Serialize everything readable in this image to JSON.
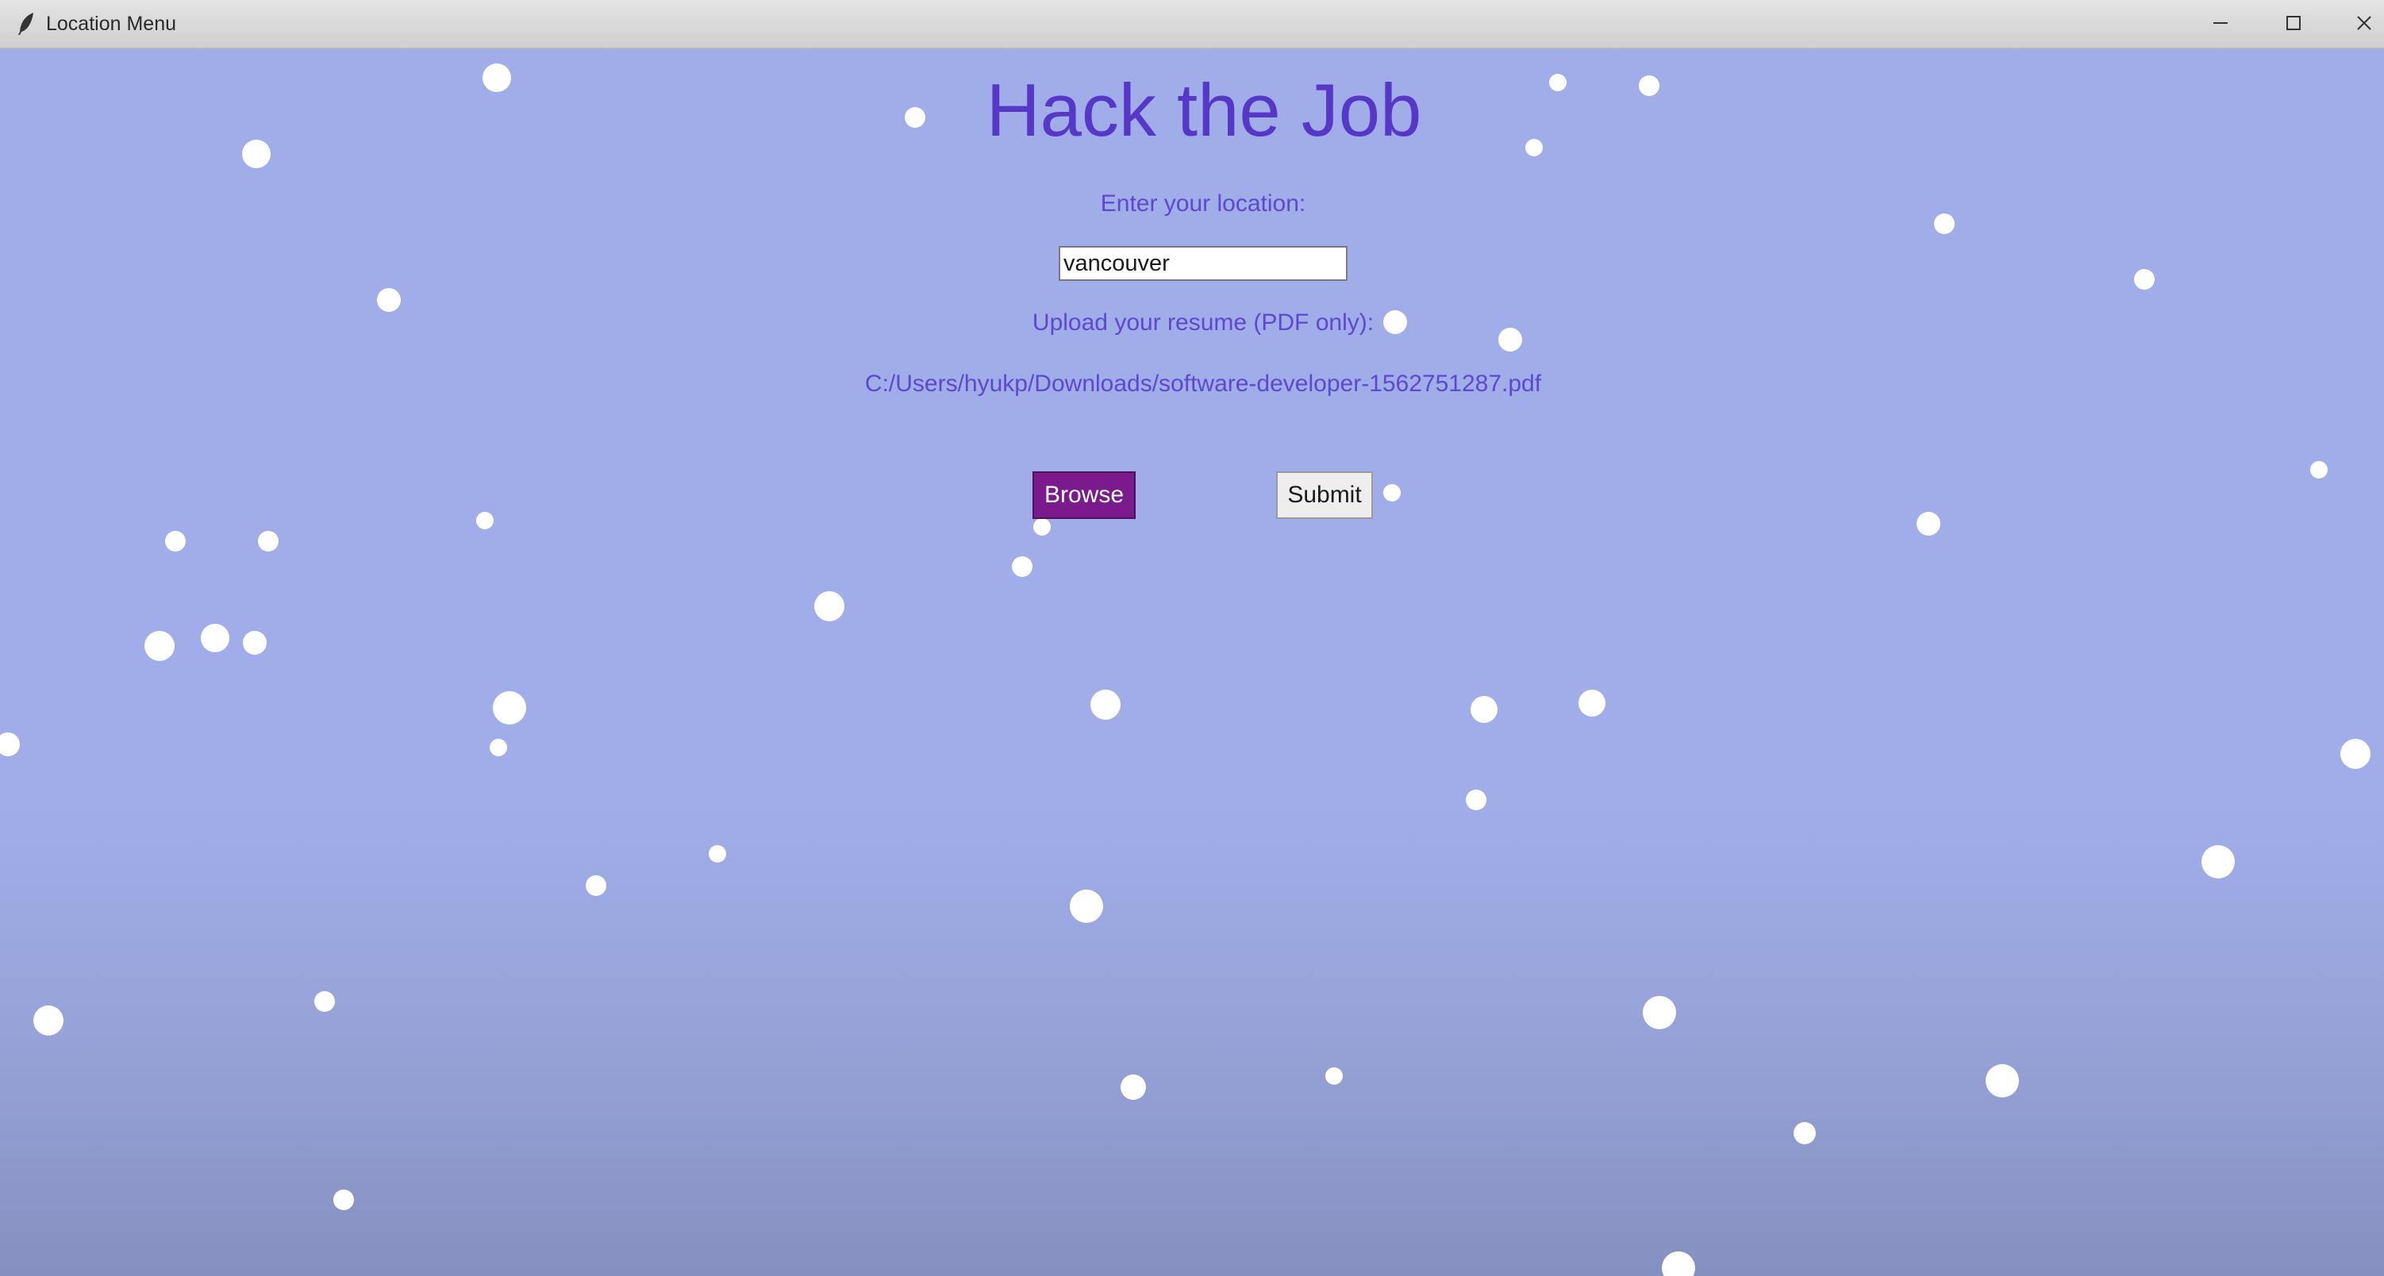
{
  "window": {
    "title": "Location Menu",
    "controls": {
      "minimize_icon": "minimize-icon",
      "maximize_icon": "maximize-icon",
      "close_icon": "close-icon"
    }
  },
  "main": {
    "heading": "Hack the Job",
    "location_label": "Enter your location:",
    "location_value": "vancouver",
    "upload_label": "Upload your resume (PDF only):",
    "file_path": "C:/Users/hyukp/Downloads/software-developer-1562751287.pdf",
    "browse_label": "Browse",
    "submit_label": "Submit"
  },
  "colors": {
    "background": "#a0ade8",
    "heading": "#5637c7",
    "label": "#5d48cf",
    "browse_button": "#7a1a8c",
    "snowflake": "#ffffff"
  }
}
